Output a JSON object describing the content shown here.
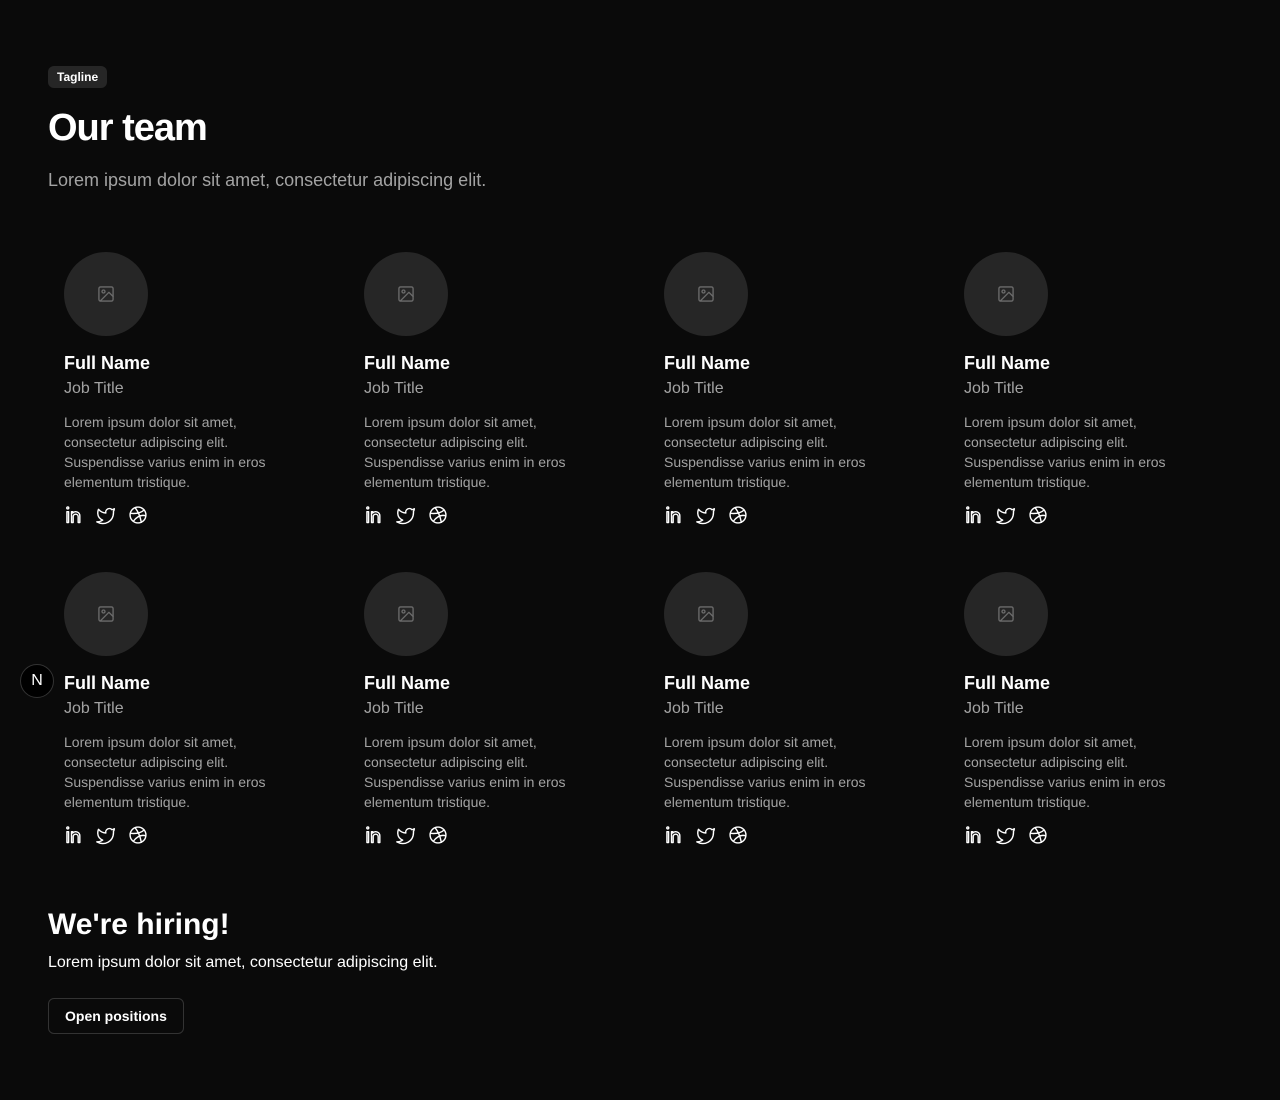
{
  "header": {
    "tagline": "Tagline",
    "title": "Our team",
    "subtitle": "Lorem ipsum dolor sit amet, consectetur adipiscing elit."
  },
  "team": [
    {
      "name": "Full Name",
      "job": "Job Title",
      "desc": "Lorem ipsum dolor sit amet, consectetur adipiscing elit. Suspendisse varius enim in eros elementum tristique."
    },
    {
      "name": "Full Name",
      "job": "Job Title",
      "desc": "Lorem ipsum dolor sit amet, consectetur adipiscing elit. Suspendisse varius enim in eros elementum tristique."
    },
    {
      "name": "Full Name",
      "job": "Job Title",
      "desc": "Lorem ipsum dolor sit amet, consectetur adipiscing elit. Suspendisse varius enim in eros elementum tristique."
    },
    {
      "name": "Full Name",
      "job": "Job Title",
      "desc": "Lorem ipsum dolor sit amet, consectetur adipiscing elit. Suspendisse varius enim in eros elementum tristique."
    },
    {
      "name": "Full Name",
      "job": "Job Title",
      "desc": "Lorem ipsum dolor sit amet, consectetur adipiscing elit. Suspendisse varius enim in eros elementum tristique."
    },
    {
      "name": "Full Name",
      "job": "Job Title",
      "desc": "Lorem ipsum dolor sit amet, consectetur adipiscing elit. Suspendisse varius enim in eros elementum tristique."
    },
    {
      "name": "Full Name",
      "job": "Job Title",
      "desc": "Lorem ipsum dolor sit amet, consectetur adipiscing elit. Suspendisse varius enim in eros elementum tristique."
    },
    {
      "name": "Full Name",
      "job": "Job Title",
      "desc": "Lorem ipsum dolor sit amet, consectetur adipiscing elit. Suspendisse varius enim in eros elementum tristique."
    }
  ],
  "social_icons": [
    "linkedin-icon",
    "twitter-icon",
    "dribbble-icon"
  ],
  "hiring": {
    "title": "We're hiring!",
    "text": "Lorem ipsum dolor sit amet, consectetur adipiscing elit.",
    "button_label": "Open positions"
  },
  "badge": {
    "letter": "N"
  },
  "colors": {
    "background": "#0a0a0a",
    "surface": "#262626",
    "text": "#ffffff",
    "muted": "#a3a3a3"
  }
}
